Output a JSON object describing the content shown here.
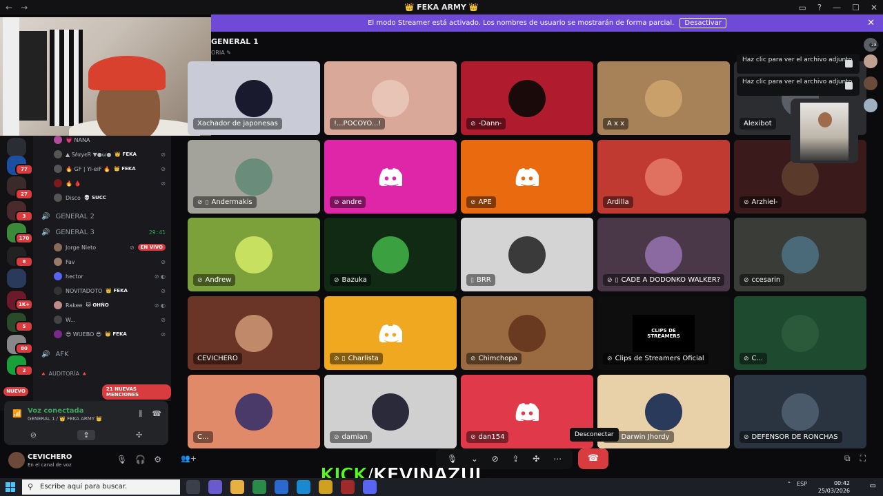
{
  "app": {
    "title": "👑 FEKA ARMY 👑",
    "nav_back": "←",
    "nav_forward": "→",
    "window_buttons": [
      "▭",
      "?",
      "—",
      "☐",
      "✕"
    ]
  },
  "streamer_banner": {
    "text": "El modo Streamer está activado. Los nombres de usuario se mostrarán de forma parcial.",
    "button": "Desactivar",
    "close": "✕"
  },
  "server_rail": {
    "badges": [
      "77",
      "27",
      "3",
      "170",
      "8",
      "1K+",
      "5",
      "80",
      "2"
    ],
    "nuevo": "NUEVO"
  },
  "sidebar": {
    "members_top": [
      {
        "name": "💗 NANA",
        "tag": "",
        "icon": ""
      },
      {
        "name": "▲ SℓαуєR ▼●ω●",
        "tag": "👑 FEKA",
        "icon": "⊘"
      },
      {
        "name": "🔥 GF | Yi-eiF 🔥",
        "tag": "👑 FEKA",
        "icon": "⊘"
      },
      {
        "name": "🔥 🩸",
        "tag": "",
        "icon": "⊘"
      },
      {
        "name": "Disco",
        "tag": "💀 SUCC",
        "icon": ""
      }
    ],
    "channel_general2": "GENERAL 2",
    "channel_general3": "GENERAL 3",
    "general3_timer": "29:41",
    "members_general3": [
      {
        "name": "Jorge Nieto",
        "tag": "",
        "live": "EN VIVO"
      },
      {
        "name": "Fav",
        "tag": "",
        "live": ""
      },
      {
        "name": "hector",
        "tag": "",
        "live": ""
      },
      {
        "name": "NOVITADOTO",
        "tag": "👑 FEKA",
        "live": ""
      },
      {
        "name": "Rakee",
        "tag": "🐱 OHÑO",
        "live": ""
      },
      {
        "name": "W...",
        "tag": "",
        "live": ""
      },
      {
        "name": "😎 WUEBO 😎",
        "tag": "👑 FEKA",
        "live": ""
      }
    ],
    "channel_afk": "AFK",
    "audit_category": "🔺 AUDITORÍA 🔺",
    "mentions": "21 NUEVAS MENCIONES"
  },
  "voice_panel": {
    "status": "Voz conectada",
    "location": "GENERAL 1 / 👑 FEKA ARMY 👑"
  },
  "user_panel": {
    "username": "CEVICHERO",
    "status": "En el canal de voz"
  },
  "voice_channel": {
    "name": "GENERAL 1",
    "sub": "ORIA"
  },
  "tiles": [
    {
      "name": "Xachador de japonesas",
      "bg": "#c9ccd6",
      "mute": false,
      "av": "#1a1a2e"
    },
    {
      "name": "!...POCOYO...!",
      "bg": "#d9a898",
      "mute": false,
      "av": "#e8c4b6"
    },
    {
      "name": "-Dann-",
      "bg": "#b01b2e",
      "mute": true,
      "av": "#1a0a0a"
    },
    {
      "name": "A x x",
      "bg": "#a78258",
      "mute": false,
      "av": "#c9a06a"
    },
    {
      "name": "Alexibot",
      "bg": "#2b2d31",
      "mute": false,
      "av": "#5a5e66"
    },
    {
      "name": "Andermakis",
      "bg": "#a3a39c",
      "mute": true,
      "phone": true,
      "av": "#6a8c7a"
    },
    {
      "name": "andre",
      "bg": "#e026a8",
      "mute": true,
      "discord": true
    },
    {
      "name": "APE",
      "bg": "#ea6a10",
      "mute": true,
      "discord": true
    },
    {
      "name": "Ardilla",
      "bg": "#c03a32",
      "mute": false,
      "av": "#e07060"
    },
    {
      "name": "Arzhiel-",
      "bg": "#3a1a1a",
      "mute": true,
      "av": "#5a3a2a"
    },
    {
      "name": "Anđrew",
      "bg": "#7ca03a",
      "mute": true,
      "av": "#c8e060"
    },
    {
      "name": "Bazuka",
      "bg": "#102a14",
      "mute": true,
      "av": "#3aa040"
    },
    {
      "name": "BRR",
      "bg": "#d4d4d4",
      "mute": false,
      "phone": true,
      "av": "#3a3a3a"
    },
    {
      "name": "CADE A DODONKO WALKER?",
      "bg": "#4a3848",
      "mute": true,
      "phone": true,
      "av": "#8a6aa0"
    },
    {
      "name": "ccesarin",
      "bg": "#3a3c38",
      "mute": true,
      "av": "#4a6a7a"
    },
    {
      "name": "CEVICHERO",
      "bg": "#6a3426",
      "mute": false,
      "av": "#c08a6a"
    },
    {
      "name": "Charlista",
      "bg": "#f0a820",
      "mute": true,
      "phone": true,
      "discord": true
    },
    {
      "name": "Chimchopa",
      "bg": "#9a6a40",
      "mute": true,
      "av": "#6a3a20"
    },
    {
      "name": "Clips de Streamers Oficial",
      "bg": "#0e0e0e",
      "mute": true,
      "av": "#000000",
      "clips": "CLIPS DE\nSTREAMERS"
    },
    {
      "name": "C...",
      "bg": "#1e4a30",
      "mute": true,
      "av": "#2a5a3a"
    },
    {
      "name": "C...",
      "bg": "#e08a6a",
      "mute": false,
      "av": "#4a3a6a"
    },
    {
      "name": "damian",
      "bg": "#d0d0d0",
      "mute": true,
      "av": "#2a2a3a"
    },
    {
      "name": "dan154",
      "bg": "#e03a4a",
      "mute": true,
      "discord": true
    },
    {
      "name": "Darwin Jhordy",
      "bg": "#e8d0a8",
      "mute": true,
      "phone": true,
      "av": "#2a3a5a"
    },
    {
      "name": "DEFENSOR DE RONCHAS",
      "bg": "#2a3440",
      "mute": true,
      "av": "#4a5a6a"
    }
  ],
  "attachments": [
    {
      "text": "Haz clic para ver el archivo adjunto"
    },
    {
      "text": "Haz clic para ver el archivo adjunto"
    }
  ],
  "right_column": {
    "count": "28"
  },
  "controls": {
    "tooltip": "Desconectar",
    "hangup_icon": "☎"
  },
  "overlay": {
    "kick": "KICK",
    "channel": "/KEVINAZUL"
  },
  "taskbar": {
    "search_placeholder": "Escribe aquí para buscar.",
    "lang": "ESP",
    "time": "00:42",
    "date": "25/03/2026"
  }
}
